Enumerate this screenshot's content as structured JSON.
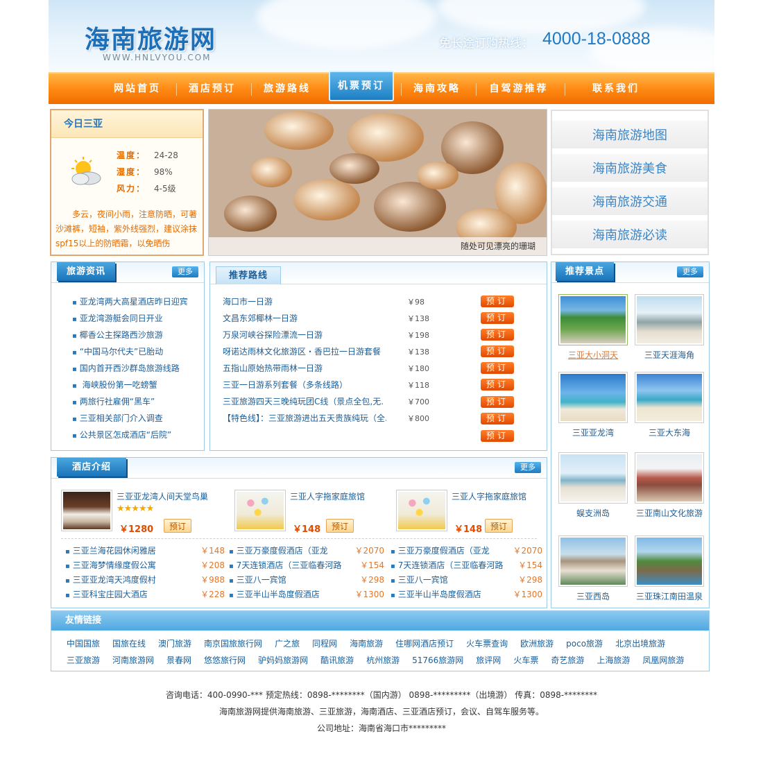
{
  "header": {
    "logo": "海南旅游网",
    "logo_sub": "WWW.HNLVYOU.COM",
    "hotline_label": "免长途订购热线：",
    "hotline_number": "4000-18-0888"
  },
  "nav": {
    "items": [
      "网站首页",
      "酒店预订",
      "旅游路线",
      "机票预订",
      "海南攻略",
      "自驾游推荐",
      "联系我们"
    ],
    "active_index": 3
  },
  "today": {
    "title": "今日三亚",
    "temp_label": "温度：",
    "temp_value": "24-28",
    "humidity_label": "湿度：",
    "humidity_value": "98%",
    "wind_label": "风力：",
    "wind_value": "4-5级",
    "description": "多云，夜间小雨，注意防晒，可著沙滩裤，短袖，紫外线强烈，建议涂抹spf15以上的防晒霜，以免晒伤"
  },
  "banner": {
    "caption": "随处可见漂亮的珊瑚"
  },
  "quick_links": [
    "海南旅游地图",
    "海南旅游美食",
    "海南旅游交通",
    "海南旅游必读"
  ],
  "news": {
    "title": "旅游资讯",
    "more": "更多",
    "items": [
      "亚龙湾两大高星酒店昨日迎宾",
      "亚龙湾游艇会同日开业",
      "椰香公主探路西沙旅游",
      "“中国马尔代夫”已胎动",
      "国内首开西沙群岛旅游线路",
      " 海峡股份第一吃螃蟹",
      "两旅行社雇佣“黑车”",
      "三亚相关部门介入调查",
      "公共景区怎成酒店“后院”"
    ]
  },
  "routes": {
    "title": "推荐路线",
    "book_label": "预订",
    "items": [
      {
        "name": "海口市一日游",
        "price": "￥98"
      },
      {
        "name": "文昌东郊椰林一日游",
        "price": "￥138"
      },
      {
        "name": "万泉河峡谷探险漂流一日游",
        "price": "￥198"
      },
      {
        "name": "呀诺达雨林文化旅游区・香巴拉一日游套餐",
        "price": "￥138"
      },
      {
        "name": "五指山原始热带雨林一日游",
        "price": "￥180"
      },
      {
        "name": "三亚一日游系列套餐（多条线路）",
        "price": "￥118"
      },
      {
        "name": "三亚旅游四天三晚纯玩团C线（景点全包,无.",
        "price": "￥700"
      },
      {
        "name": "【特色线】：三亚旅游进出五天贵族纯玩（全.",
        "price": "￥800"
      }
    ]
  },
  "spots": {
    "title": "推荐景点",
    "more": "更多",
    "items": [
      "三亚大小洞天",
      "三亚天涯海角",
      "三亚亚龙湾",
      "三亚大东海",
      "蜈支洲岛",
      "三亚南山文化旅游",
      "三亚西岛",
      "三亚珠江南田温泉"
    ]
  },
  "hotels": {
    "title": "酒店介绍",
    "more": "更多",
    "book_label": "预订",
    "featured": [
      {
        "name": "三亚亚龙湾人间天堂鸟巢",
        "price": "￥1280",
        "stars": "★★★★★"
      },
      {
        "name": "三亚人字拖家庭旅馆",
        "price": "￥148"
      },
      {
        "name": "三亚人字拖家庭旅馆",
        "price": "￥148"
      }
    ],
    "lists": [
      [
        {
          "name": "三亚兰海花园休闲雅居",
          "price": "￥148"
        },
        {
          "name": "三亚海梦情缘度假公寓",
          "price": "￥208"
        },
        {
          "name": "三亚亚龙湾天鸿度假村",
          "price": "￥988"
        },
        {
          "name": "三亚科宝庄园大酒店",
          "price": "￥228"
        }
      ],
      [
        {
          "name": "三亚万豪度假酒店（亚龙",
          "price": "￥2070"
        },
        {
          "name": "7天连锁酒店（三亚临春河路",
          "price": "￥154"
        },
        {
          "name": "三亚八一宾馆",
          "price": "￥298"
        },
        {
          "name": "三亚半山半岛度假酒店",
          "price": "￥1300"
        }
      ],
      [
        {
          "name": "三亚万豪度假酒店（亚龙",
          "price": "￥2070"
        },
        {
          "name": "7天连锁酒店（三亚临春河路",
          "price": "￥154"
        },
        {
          "name": "三亚八一宾馆",
          "price": "￥298"
        },
        {
          "name": "三亚半山半岛度假酒店",
          "price": "￥1300"
        }
      ]
    ]
  },
  "friend_links": {
    "title": "友情链接",
    "row1": [
      "中国国旅",
      "国旅在线",
      "澳门旅游",
      "南京国旅旅行网",
      "广之旅",
      "同程网",
      "海南旅游",
      "住哪网酒店预订",
      "火车票查询",
      "欧洲旅游",
      "poco旅游",
      "北京出境旅游"
    ],
    "row2": [
      "三亚旅游",
      "河南旅游网",
      "景春网",
      "悠悠旅行网",
      "驴妈妈旅游网",
      "酷讯旅游",
      "杭州旅游",
      "51766旅游网",
      "旅评网",
      "火车票",
      "奇艺旅游",
      "上海旅游",
      "凤凰网旅游"
    ]
  },
  "footer": {
    "line1": "咨询电话：400-0990-***    预定热线：0898-********（国内游）  0898-*********（出境游）    传真：0898-********",
    "line2": "海南旅游网提供海南旅游、三亚旅游，海南酒店、三亚酒店预订，会议、自驾车服务等。",
    "line3": "公司地址：海南省海口市*********"
  },
  "colors": {
    "nav_orange": "#ff8a14",
    "accent_blue": "#1f79c4",
    "price_orange": "#e24a00"
  }
}
